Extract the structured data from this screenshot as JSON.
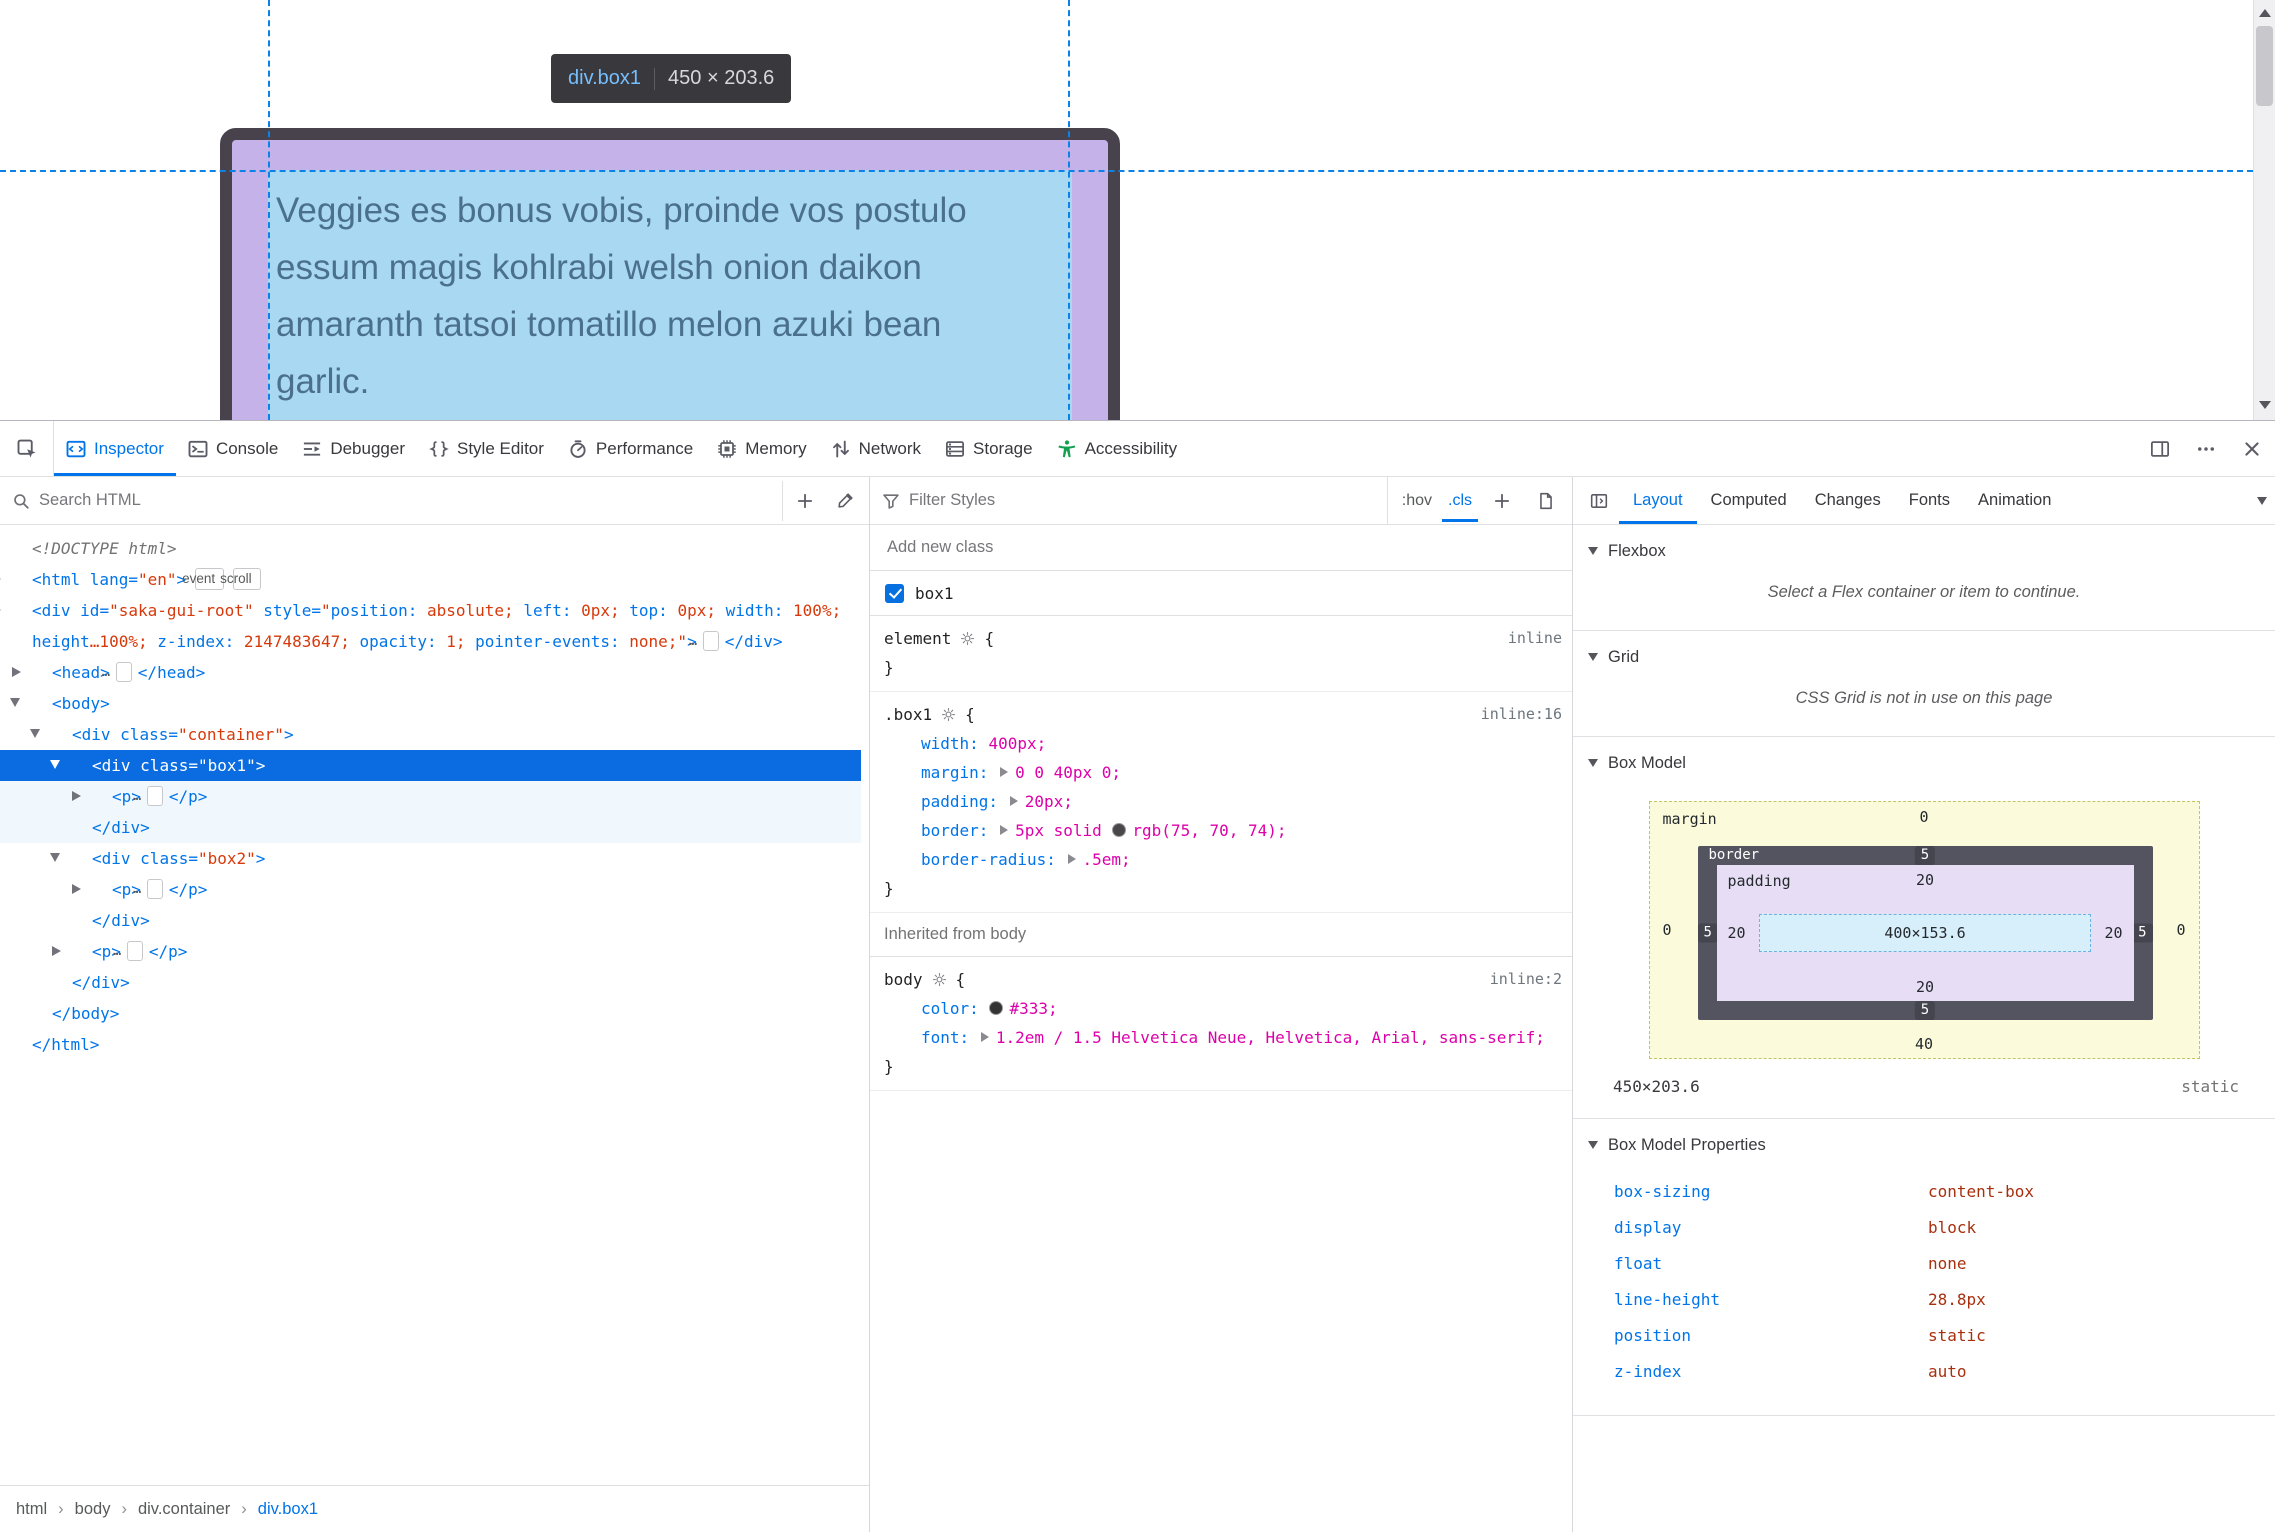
{
  "colors": {
    "accent_blue": "#0074e8",
    "attr_value_red": "#d7390b",
    "css_value_magenta": "#dd00a9",
    "computed_value_red": "#a8300f",
    "border_swatch": "#4b464a",
    "body_color_swatch": "#333333",
    "accessibility_green": "#12a050",
    "selected_row_blue": "#0a6ce0"
  },
  "page": {
    "highlight": {
      "selector_tag": "div",
      "selector_class": ".box1",
      "dimensions": "450 × 203.6"
    },
    "paragraph": "Veggies es bonus vobis, proinde vos postulo essum magis kohlrabi welsh onion daikon amaranth tatsoi tomatillo melon azuki bean garlic."
  },
  "toolbar": {
    "tabs": [
      {
        "id": "inspector",
        "label": "Inspector",
        "active": true
      },
      {
        "id": "console",
        "label": "Console"
      },
      {
        "id": "debugger",
        "label": "Debugger"
      },
      {
        "id": "style-editor",
        "label": "Style Editor"
      },
      {
        "id": "performance",
        "label": "Performance"
      },
      {
        "id": "memory",
        "label": "Memory"
      },
      {
        "id": "network",
        "label": "Network"
      },
      {
        "id": "storage",
        "label": "Storage"
      },
      {
        "id": "accessibility",
        "label": "Accessibility"
      }
    ]
  },
  "markup": {
    "search_placeholder": "Search HTML",
    "rows": [
      {
        "level": 0,
        "twisty": "none",
        "segs": [
          {
            "t": "<!DOCTYPE html>",
            "c": "doctype"
          }
        ]
      },
      {
        "level": 0,
        "twisty": "closed",
        "segs": [
          {
            "t": "<html ",
            "c": "tag"
          },
          {
            "t": "lang=",
            "c": "attr"
          },
          {
            "t": "\"en\"",
            "c": "val"
          },
          {
            "t": ">",
            "c": "tag"
          },
          {
            "t": "event",
            "c": "badge"
          },
          {
            "t": "scroll",
            "c": "badge"
          }
        ]
      },
      {
        "level": 0,
        "twisty": "closed",
        "segs": [
          {
            "t": "<div ",
            "c": "tag"
          },
          {
            "t": "id=",
            "c": "attr"
          },
          {
            "t": "\"saka-gui-root\" ",
            "c": "val"
          },
          {
            "t": "style=",
            "c": "attr"
          },
          {
            "t": "\"",
            "c": "val"
          },
          {
            "t": "position:",
            "c": "attr"
          },
          {
            "t": " absolute; ",
            "c": "val"
          },
          {
            "t": "left:",
            "c": "attr"
          },
          {
            "t": " 0px; ",
            "c": "val"
          },
          {
            "t": "top:",
            "c": "attr"
          },
          {
            "t": " 0px; ",
            "c": "val"
          },
          {
            "t": "width:",
            "c": "attr"
          },
          {
            "t": " 100%; ",
            "c": "val"
          },
          {
            "t": "height",
            "c": "attr"
          },
          {
            "t": "…100%; ",
            "c": "val"
          },
          {
            "t": "z-index:",
            "c": "attr"
          },
          {
            "t": " 2147483647; ",
            "c": "val"
          },
          {
            "t": "opacity:",
            "c": "attr"
          },
          {
            "t": " 1; ",
            "c": "val"
          },
          {
            "t": "pointer-events:",
            "c": "attr"
          },
          {
            "t": " none;\"",
            "c": "val"
          },
          {
            "t": ">",
            "c": "tag"
          },
          {
            "t": "…",
            "c": "ell"
          },
          {
            "t": "</div>",
            "c": "tag"
          }
        ]
      },
      {
        "level": 1,
        "twisty": "closed",
        "segs": [
          {
            "t": "<head>",
            "c": "tag"
          },
          {
            "t": "…",
            "c": "ell"
          },
          {
            "t": "</head>",
            "c": "tag"
          }
        ]
      },
      {
        "level": 1,
        "twisty": "open",
        "segs": [
          {
            "t": "<body>",
            "c": "tag"
          }
        ]
      },
      {
        "level": 2,
        "twisty": "open",
        "segs": [
          {
            "t": "<div ",
            "c": "tag"
          },
          {
            "t": "class=",
            "c": "attr"
          },
          {
            "t": "\"container\"",
            "c": "val"
          },
          {
            "t": ">",
            "c": "tag"
          }
        ]
      },
      {
        "level": 3,
        "twisty": "open",
        "state": "selected",
        "segs": [
          {
            "t": "<div ",
            "c": "tag"
          },
          {
            "t": "class=",
            "c": "attr"
          },
          {
            "t": "\"box1\"",
            "c": "val"
          },
          {
            "t": ">",
            "c": "tag"
          }
        ]
      },
      {
        "level": 4,
        "twisty": "closed",
        "state": "tint",
        "segs": [
          {
            "t": "<p>",
            "c": "tag"
          },
          {
            "t": "…",
            "c": "ell"
          },
          {
            "t": "</p>",
            "c": "tag"
          }
        ]
      },
      {
        "level": 3,
        "twisty": "none",
        "state": "tint",
        "segs": [
          {
            "t": "</div>",
            "c": "tag"
          }
        ]
      },
      {
        "level": 3,
        "twisty": "open",
        "segs": [
          {
            "t": "<div ",
            "c": "tag"
          },
          {
            "t": "class=",
            "c": "attr"
          },
          {
            "t": "\"box2\"",
            "c": "val"
          },
          {
            "t": ">",
            "c": "tag"
          }
        ]
      },
      {
        "level": 4,
        "twisty": "closed",
        "segs": [
          {
            "t": "<p>",
            "c": "tag"
          },
          {
            "t": "…",
            "c": "ell"
          },
          {
            "t": "</p>",
            "c": "tag"
          }
        ]
      },
      {
        "level": 3,
        "twisty": "none",
        "segs": [
          {
            "t": "</div>",
            "c": "tag"
          }
        ]
      },
      {
        "level": 3,
        "twisty": "closed",
        "segs": [
          {
            "t": "<p>",
            "c": "tag"
          },
          {
            "t": "…",
            "c": "ell"
          },
          {
            "t": "</p>",
            "c": "tag"
          }
        ]
      },
      {
        "level": 2,
        "twisty": "none",
        "segs": [
          {
            "t": "</div>",
            "c": "tag"
          }
        ]
      },
      {
        "level": 1,
        "twisty": "none",
        "segs": [
          {
            "t": "</body>",
            "c": "tag"
          }
        ]
      },
      {
        "level": 0,
        "twisty": "none",
        "segs": [
          {
            "t": "</html>",
            "c": "tag"
          }
        ]
      }
    ],
    "breadcrumbs": [
      {
        "label": "html"
      },
      {
        "label": "body"
      },
      {
        "label": "div.container"
      },
      {
        "label": "div.box1",
        "selected": true
      }
    ]
  },
  "rules": {
    "filter_placeholder": "Filter Styles",
    "hov": ":hov",
    "cls": ".cls",
    "add_class_placeholder": "Add new class",
    "class_toggle": {
      "label": "box1",
      "checked": true
    },
    "rules": [
      {
        "selector": "element",
        "location": "inline",
        "props": []
      },
      {
        "selector": ".box1",
        "location": "inline:16",
        "props": [
          {
            "name": "width",
            "value": [
              {
                "t": "400px;"
              }
            ]
          },
          {
            "name": "margin",
            "arrow": true,
            "value": [
              {
                "t": "0 0 40px 0;"
              }
            ]
          },
          {
            "name": "padding",
            "arrow": true,
            "value": [
              {
                "t": "20px;"
              }
            ]
          },
          {
            "name": "border",
            "arrow": true,
            "value": [
              {
                "t": "5px solid "
              },
              {
                "swatch": "#4b464a"
              },
              {
                "t": "rgb(75, 70, 74);"
              }
            ]
          },
          {
            "name": "border-radius",
            "arrow": true,
            "value": [
              {
                "t": ".5em;"
              }
            ]
          }
        ]
      }
    ],
    "inherited_header": "Inherited from body",
    "inherited_rules": [
      {
        "selector": "body",
        "location": "inline:2",
        "props": [
          {
            "name": "color",
            "value": [
              {
                "swatch": "#333333"
              },
              {
                "t": "#333;"
              }
            ]
          },
          {
            "name": "font",
            "arrow": true,
            "value": [
              {
                "t": "1.2em / 1.5 Helvetica Neue, Helvetica, Arial, sans-serif;"
              }
            ]
          }
        ]
      }
    ]
  },
  "layout": {
    "tabs": [
      {
        "label": "Layout",
        "active": true
      },
      {
        "label": "Computed"
      },
      {
        "label": "Changes"
      },
      {
        "label": "Fonts"
      },
      {
        "label": "Animations",
        "truncated": true
      }
    ],
    "flexbox": {
      "title": "Flexbox",
      "message": "Select a Flex container or item to continue."
    },
    "grid": {
      "title": "Grid",
      "message": "CSS Grid is not in use on this page"
    },
    "box_model": {
      "title": "Box Model",
      "margin_label": "margin",
      "border_label": "border",
      "padding_label": "padding",
      "margin": {
        "top": "0",
        "right": "0",
        "bottom": "40",
        "left": "0"
      },
      "border": {
        "top": "5",
        "right": "5",
        "bottom": "5",
        "left": "5"
      },
      "padding": {
        "top": "20",
        "right": "20",
        "bottom": "20",
        "left": "20"
      },
      "content": "400×153.6",
      "element_size": "450×203.6",
      "element_position": "static"
    },
    "properties_title": "Box Model Properties",
    "properties": [
      {
        "name": "box-sizing",
        "value": "content-box"
      },
      {
        "name": "display",
        "value": "block"
      },
      {
        "name": "float",
        "value": "none"
      },
      {
        "name": "line-height",
        "value": "28.8px"
      },
      {
        "name": "position",
        "value": "static"
      },
      {
        "name": "z-index",
        "value": "auto"
      }
    ]
  }
}
